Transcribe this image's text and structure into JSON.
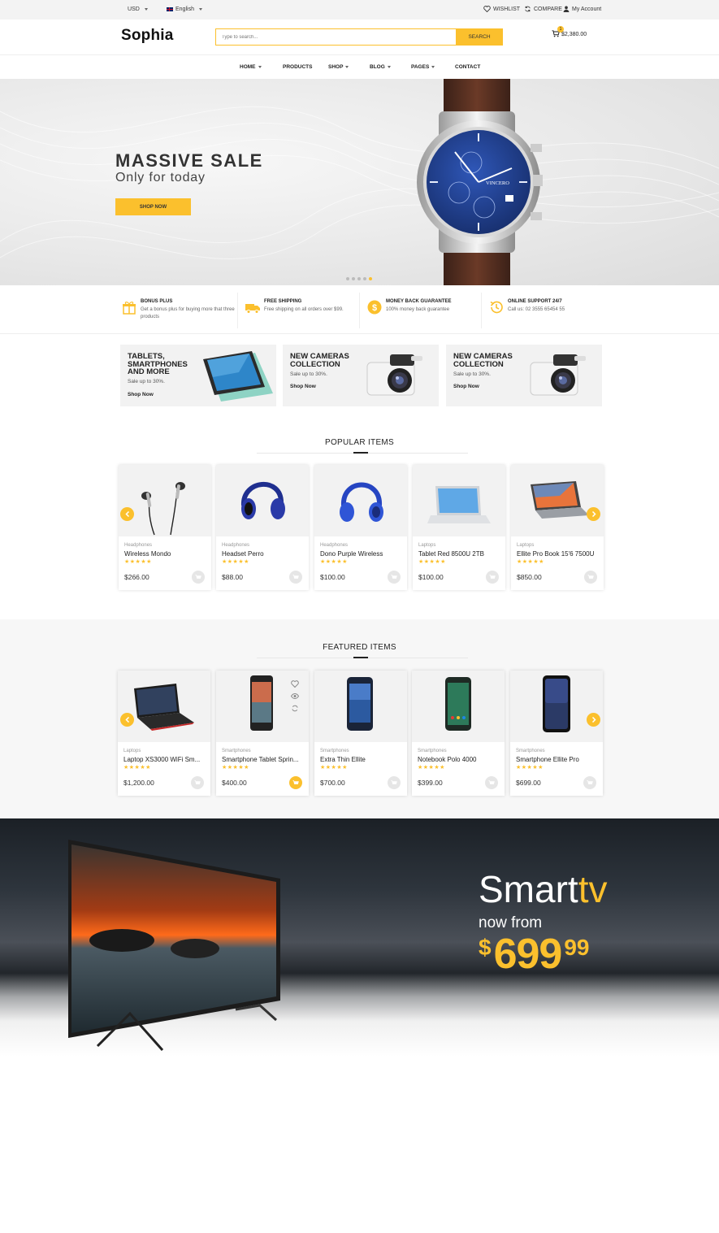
{
  "topbar": {
    "currency": "USD",
    "language": "English",
    "wishlist": "WISHLIST",
    "compare": "COMPARE",
    "account": "My Account"
  },
  "header": {
    "logo": "Sophia",
    "search_placeholder": "Type to search...",
    "search_button": "SEARCH",
    "cart_count": "1",
    "cart_total": "$2,380.00"
  },
  "nav": [
    "HOME",
    "PRODUCTS",
    "SHOP",
    "BLOG",
    "PAGES",
    "CONTACT"
  ],
  "hero": {
    "title": "MASSIVE SALE",
    "subtitle": "Only for today",
    "button": "SHOP NOW",
    "watch_brand": "VINCERO",
    "slides": 5,
    "active_slide": 5
  },
  "features": [
    {
      "title": "BONUS PLUS",
      "desc": "Get a bonus plus for buying more that three products",
      "icon": "gift-icon"
    },
    {
      "title": "FREE SHIPPING",
      "desc": "Free shipping on all orders over $99.",
      "icon": "truck-icon"
    },
    {
      "title": "MONEY BACK GUARANTEE",
      "desc": "100% money back guarantee",
      "icon": "dollar-icon"
    },
    {
      "title": "ONLINE SUPPORT 24/7",
      "desc": "Call us: 02 3555 65454 55",
      "icon": "history-icon"
    }
  ],
  "promos": [
    {
      "title": "TABLETS, SMARTPHONES AND MORE",
      "desc": "Sale up to 30%.",
      "link": "Shop Now"
    },
    {
      "title": "NEW CAMERAS COLLECTION",
      "desc": "Sale up to 30%.",
      "link": "Shop Now"
    },
    {
      "title": "NEW CAMERAS COLLECTION",
      "desc": "Sale up to 30%.",
      "link": "Shop Now"
    }
  ],
  "popular": {
    "title": "POPULAR ITEMS",
    "items": [
      {
        "category": "Headphones",
        "name": "Wireless Mondo",
        "price": "$266.00",
        "rating": 5
      },
      {
        "category": "Headphones",
        "name": "Headset Perro",
        "price": "$88.00",
        "rating": 5
      },
      {
        "category": "Headphones",
        "name": "Dono Purple Wireless",
        "price": "$100.00",
        "rating": 5
      },
      {
        "category": "Laptops",
        "name": "Tablet Red 8500U 2TB",
        "price": "$100.00",
        "rating": 5
      },
      {
        "category": "Laptops",
        "name": "Ellite Pro Book 15'6 7500U",
        "price": "$850.00",
        "rating": 5
      }
    ]
  },
  "featured": {
    "title": "FEATURED ITEMS",
    "items": [
      {
        "category": "Laptops",
        "name": "Laptop XS3000 WiFi Sm...",
        "price": "$1,200.00",
        "rating": 5
      },
      {
        "category": "Smartphones",
        "name": "Smartphone Tablet Sprin...",
        "price": "$400.00",
        "rating": 5
      },
      {
        "category": "Smartphones",
        "name": "Extra Thin Ellite",
        "price": "$700.00",
        "rating": 5
      },
      {
        "category": "Smartphones",
        "name": "Notebook Polo 4000",
        "price": "$399.00",
        "rating": 5
      },
      {
        "category": "Smartphones",
        "name": "Smartphone Ellite Pro",
        "price": "$699.00",
        "rating": 5
      }
    ]
  },
  "smarttv": {
    "word1": "Smart",
    "word2": "tv",
    "now_from": "now from",
    "currency": "$",
    "price_whole": "699",
    "price_cents": "99"
  },
  "colors": {
    "accent": "#fbc02d",
    "text": "#222222",
    "muted": "#999999",
    "banner_bg": "#f2f2f2"
  }
}
